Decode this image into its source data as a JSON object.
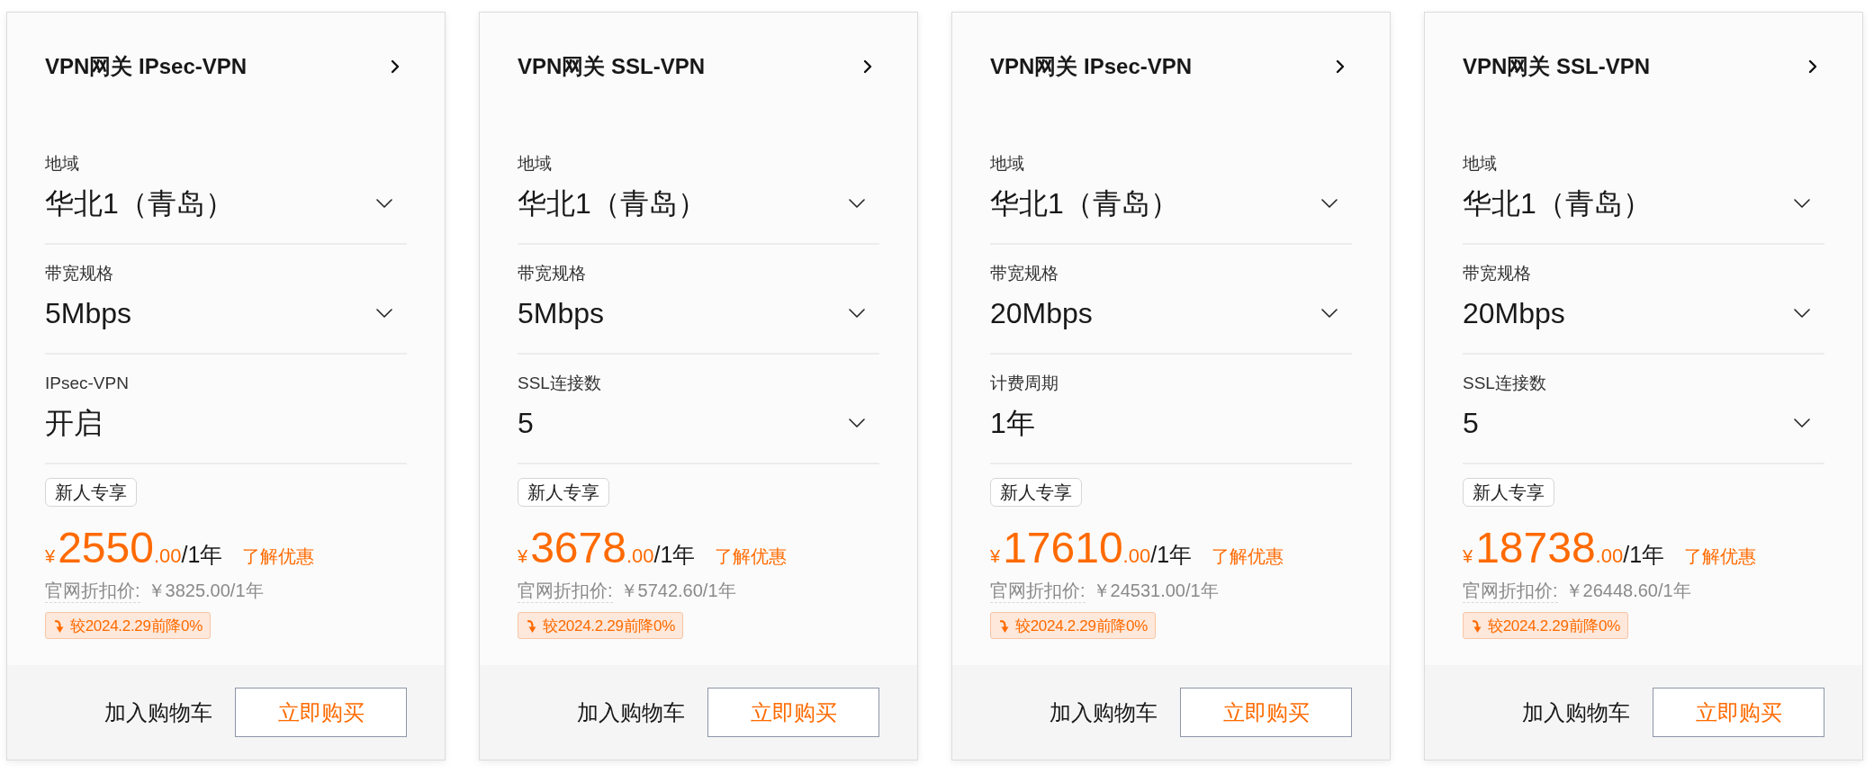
{
  "cards": [
    {
      "title": "VPN网关 IPsec-VPN",
      "fields": [
        {
          "label": "地域",
          "value": "华北1（青岛）",
          "kind": "select"
        },
        {
          "label": "带宽规格",
          "value": "5Mbps",
          "kind": "select"
        },
        {
          "label": "IPsec-VPN",
          "value": "开启",
          "kind": "static"
        }
      ],
      "badge": "新人专享",
      "price": {
        "currency": "¥",
        "amount": "2550",
        "decimals": ".00",
        "period": "/1年"
      },
      "offer_link": "了解优惠",
      "list_price": {
        "label": "官网折扣价:",
        "value": "￥3825.00/1年"
      },
      "price_change": "较2024.2.29前降0%",
      "actions": {
        "cart": "加入购物车",
        "buy": "立即购买"
      }
    },
    {
      "title": "VPN网关 SSL-VPN",
      "fields": [
        {
          "label": "地域",
          "value": "华北1（青岛）",
          "kind": "select"
        },
        {
          "label": "带宽规格",
          "value": "5Mbps",
          "kind": "select"
        },
        {
          "label": "SSL连接数",
          "value": "5",
          "kind": "select"
        }
      ],
      "badge": "新人专享",
      "price": {
        "currency": "¥",
        "amount": "3678",
        "decimals": ".00",
        "period": "/1年"
      },
      "offer_link": "了解优惠",
      "list_price": {
        "label": "官网折扣价:",
        "value": "￥5742.60/1年"
      },
      "price_change": "较2024.2.29前降0%",
      "actions": {
        "cart": "加入购物车",
        "buy": "立即购买"
      }
    },
    {
      "title": "VPN网关 IPsec-VPN",
      "fields": [
        {
          "label": "地域",
          "value": "华北1（青岛）",
          "kind": "select"
        },
        {
          "label": "带宽规格",
          "value": "20Mbps",
          "kind": "select"
        },
        {
          "label": "计费周期",
          "value": "1年",
          "kind": "static"
        }
      ],
      "badge": "新人专享",
      "price": {
        "currency": "¥",
        "amount": "17610",
        "decimals": ".00",
        "period": "/1年"
      },
      "offer_link": "了解优惠",
      "list_price": {
        "label": "官网折扣价:",
        "value": "￥24531.00/1年"
      },
      "price_change": "较2024.2.29前降0%",
      "actions": {
        "cart": "加入购物车",
        "buy": "立即购买"
      }
    },
    {
      "title": "VPN网关 SSL-VPN",
      "fields": [
        {
          "label": "地域",
          "value": "华北1（青岛）",
          "kind": "select"
        },
        {
          "label": "带宽规格",
          "value": "20Mbps",
          "kind": "select"
        },
        {
          "label": "SSL连接数",
          "value": "5",
          "kind": "select"
        }
      ],
      "badge": "新人专享",
      "price": {
        "currency": "¥",
        "amount": "18738",
        "decimals": ".00",
        "period": "/1年"
      },
      "offer_link": "了解优惠",
      "list_price": {
        "label": "官网折扣价:",
        "value": "￥26448.60/1年"
      },
      "price_change": "较2024.2.29前降0%",
      "actions": {
        "cart": "加入购物车",
        "buy": "立即购买"
      }
    }
  ]
}
